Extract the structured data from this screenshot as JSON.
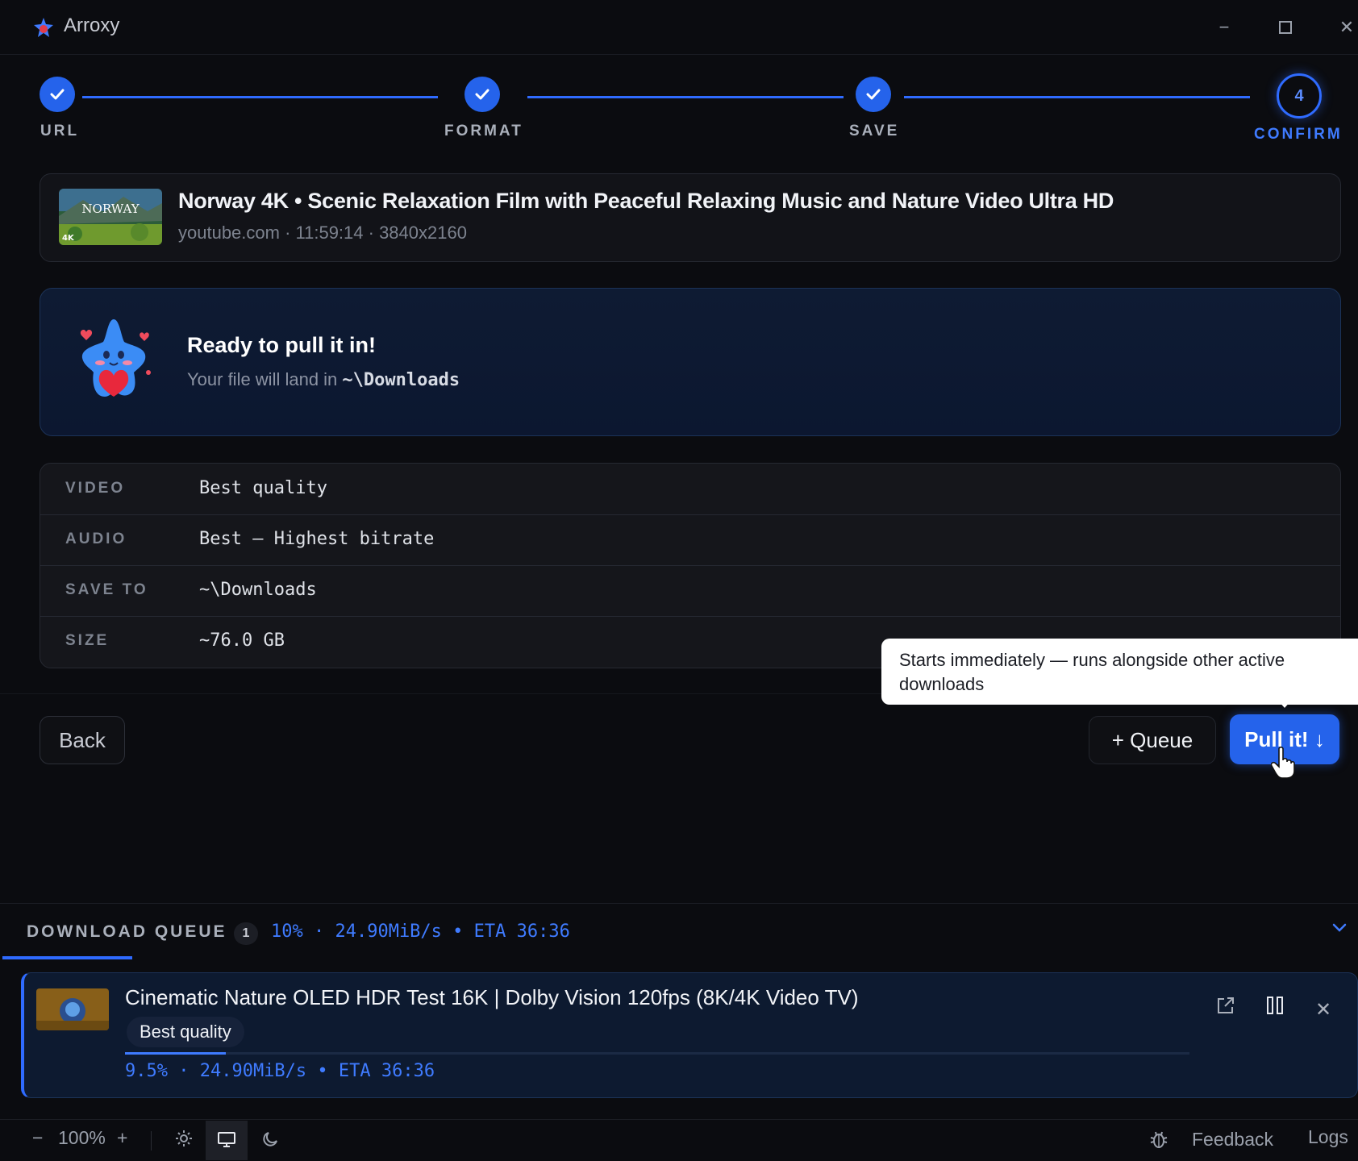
{
  "window": {
    "title": "Arroxy",
    "minimize_icon": "minimize-icon",
    "maximize_icon": "maximize-icon",
    "close_icon": "close-icon"
  },
  "stepper": {
    "steps": [
      {
        "label": "URL",
        "state": "done"
      },
      {
        "label": "FORMAT",
        "state": "done"
      },
      {
        "label": "SAVE",
        "state": "done"
      },
      {
        "label": "CONFIRM",
        "state": "active",
        "number": "4"
      }
    ],
    "accent": "#2f6bff"
  },
  "video": {
    "title": "Norway 4K • Scenic Relaxation Film with Peaceful Relaxing Music and Nature Video Ultra HD",
    "meta": "youtube.com · 11:59:14 · 3840x2160",
    "thumb_text": "NORWAY",
    "thumb_badge": "4K"
  },
  "ready": {
    "title": "Ready to pull it in!",
    "subtitle_prefix": "Your file will land in ",
    "path": "~\\Downloads"
  },
  "summary": {
    "rows": [
      {
        "key": "VIDEO",
        "value": "Best quality"
      },
      {
        "key": "AUDIO",
        "value": "Best — Highest bitrate"
      },
      {
        "key": "SAVE TO",
        "value": "~\\Downloads"
      },
      {
        "key": "SIZE",
        "value": "~76.0 GB"
      }
    ]
  },
  "actions": {
    "back_label": "Back",
    "queue_label": "+ Queue",
    "pull_label": "Pull it! ↓",
    "tooltip_line1": "Starts immediately — runs alongside other active",
    "tooltip_line2": "downloads"
  },
  "queue": {
    "title": "DOWNLOAD QUEUE",
    "count": "1",
    "stats": "10% · 24.90MiB/s • ETA 36:36",
    "items": [
      {
        "title": "Cinematic Nature OLED HDR Test 16K | Dolby Vision 120fps (8K/4K Video TV)",
        "quality": "Best quality",
        "progress": 0.095,
        "stats": "9.5% · 24.90MiB/s • ETA 36:36"
      }
    ]
  },
  "statusbar": {
    "zoom": "100%",
    "zoom_out": "−",
    "zoom_in": "+",
    "feedback": "Feedback",
    "logs": "Logs"
  },
  "colors": {
    "background": "#0b0c10",
    "accent": "#2563eb",
    "accent_text": "#3f7bff"
  }
}
